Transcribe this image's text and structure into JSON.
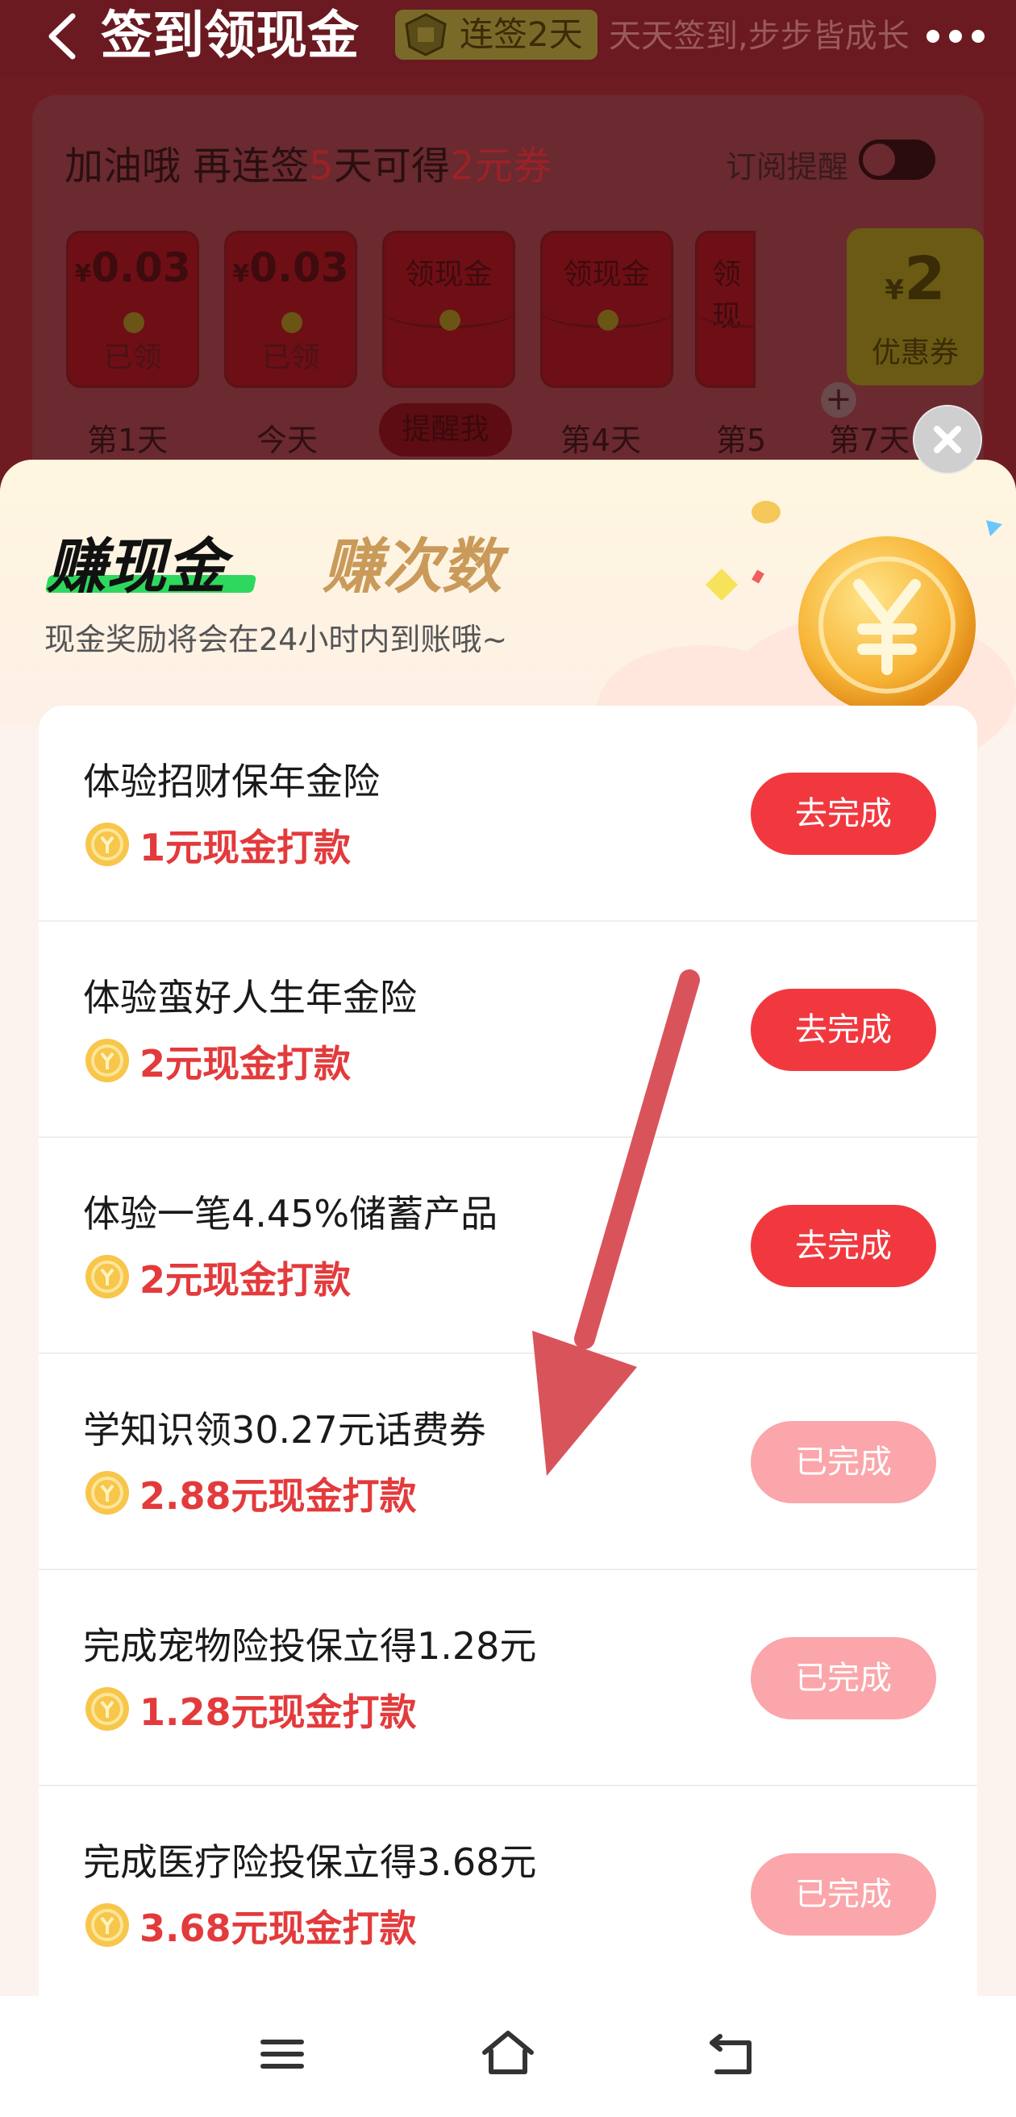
{
  "header": {
    "title": "签到领现金",
    "streak_badge": "连签2天",
    "slogan": "天天签到,步步皆成长"
  },
  "signin": {
    "headline_pre": "加油哦 再连签",
    "headline_days": "5",
    "headline_mid": "天可得",
    "headline_amount": "2元券",
    "reminder_label": "订阅提醒",
    "reminder_enabled": false,
    "days": [
      {
        "amount_prefix": "¥",
        "amount": "0.03",
        "status": "已领",
        "label": "第1天"
      },
      {
        "amount_prefix": "¥",
        "amount": "0.03",
        "status": "已领",
        "label": "今天"
      },
      {
        "flap_title": "领现金",
        "button": "提醒我"
      },
      {
        "flap_title": "领现金",
        "label": "第4天"
      },
      {
        "flap_title": "领现",
        "label": "第5"
      },
      {
        "label": "第7天"
      }
    ],
    "coupon": {
      "amount_prefix": "¥",
      "amount": "2",
      "label": "优惠券"
    }
  },
  "sheet": {
    "tab_cash": "赚现金",
    "tab_times": "赚次数",
    "subtitle": "现金奖励将会在24小时内到账哦~",
    "tasks": [
      {
        "title": "体验招财保年金险",
        "reward": "1元现金打款",
        "button": "去完成",
        "done": false
      },
      {
        "title": "体验蛮好人生年金险",
        "reward": "2元现金打款",
        "button": "去完成",
        "done": false
      },
      {
        "title": "体验一笔4.45%储蓄产品",
        "reward": "2元现金打款",
        "button": "去完成",
        "done": false
      },
      {
        "title": "学知识领30.27元话费券",
        "reward": "2.88元现金打款",
        "button": "已完成",
        "done": true
      },
      {
        "title": "完成宠物险投保立得1.28元",
        "reward": "1.28元现金打款",
        "button": "已完成",
        "done": true
      },
      {
        "title": "完成医疗险投保立得3.68元",
        "reward": "3.68元现金打款",
        "button": "已完成",
        "done": true
      }
    ]
  },
  "colors": {
    "accent_red": "#f2383f",
    "done_pink": "#fba6aa",
    "reward_red": "#e33a3c",
    "tab_underline_green": "#2ed85f",
    "annotation_arrow": "#d9535b"
  },
  "icons": [
    "back-arrow-icon",
    "more-icon",
    "close-icon",
    "coin-icon",
    "yuan-coin-icon",
    "menu-icon",
    "home-icon",
    "back-icon"
  ]
}
